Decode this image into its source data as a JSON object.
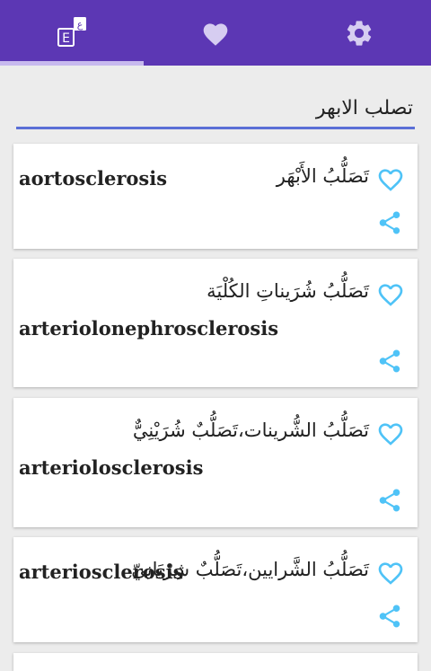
{
  "colors": {
    "primary": "#5c37b4",
    "indicator": "#c7b9ee",
    "accent": "#4fc3f7",
    "underline": "#5b6fd6"
  },
  "tabs": [
    {
      "icon": "dictionary-icon",
      "selected": true,
      "badge_letters": [
        "E",
        "ع"
      ]
    },
    {
      "icon": "heart-icon",
      "selected": false
    },
    {
      "icon": "gear-icon",
      "selected": false
    }
  ],
  "search": {
    "value": "تصلب الابهر"
  },
  "results": [
    {
      "arabic": "تَصَلُّبُ الأَبْهَر",
      "english": "aortosclerosis"
    },
    {
      "arabic": "تَصَلُّبُ شُرَيناتِ الكُلْيَة",
      "english": "arteriolonephrosclerosis"
    },
    {
      "arabic": "تَصَلُّبُ الشُّرينات،تَصَلُّبٌ شُرَيْنِيٌّ",
      "english": "arteriolosclerosis"
    },
    {
      "arabic": "تَصَلُّبُ الشَّرايين،تَصَلُّبٌ شِرْيَانِيّ",
      "english": "arteriosclerosis"
    }
  ]
}
